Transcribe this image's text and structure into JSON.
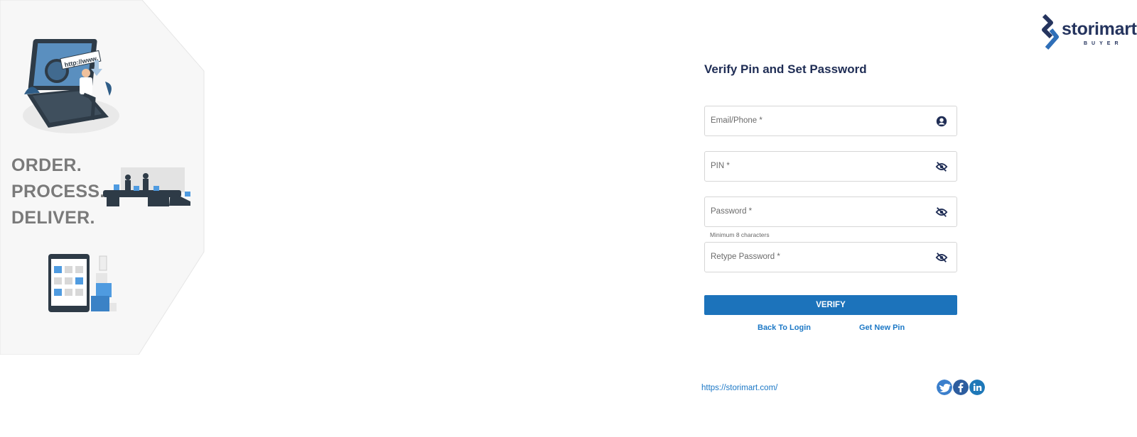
{
  "brand": {
    "name": "storimart",
    "sub": "BUYER",
    "color": "#25345e",
    "accent": "#1c73bb"
  },
  "left_panel": {
    "tagline": [
      "ORDER.",
      "PROCESS.",
      "DELIVER."
    ],
    "illustration_text": "http://www."
  },
  "form": {
    "title": "Verify Pin and Set Password",
    "fields": [
      {
        "placeholder": "Email/Phone *",
        "icon": "user-circle-icon"
      },
      {
        "placeholder": "PIN *",
        "icon": "eye-slash-icon"
      },
      {
        "placeholder": "Password *",
        "icon": "eye-slash-icon"
      },
      {
        "placeholder": "Retype Password *",
        "icon": "eye-slash-icon"
      }
    ],
    "password_hint": "Minimum 8 characters",
    "verify_label": "VERIFY",
    "back_link": "Back To Login",
    "new_pin_link": "Get New Pin"
  },
  "footer": {
    "url": "https://storimart.com/",
    "social": [
      "twitter-icon",
      "facebook-icon",
      "linkedin-icon"
    ]
  }
}
